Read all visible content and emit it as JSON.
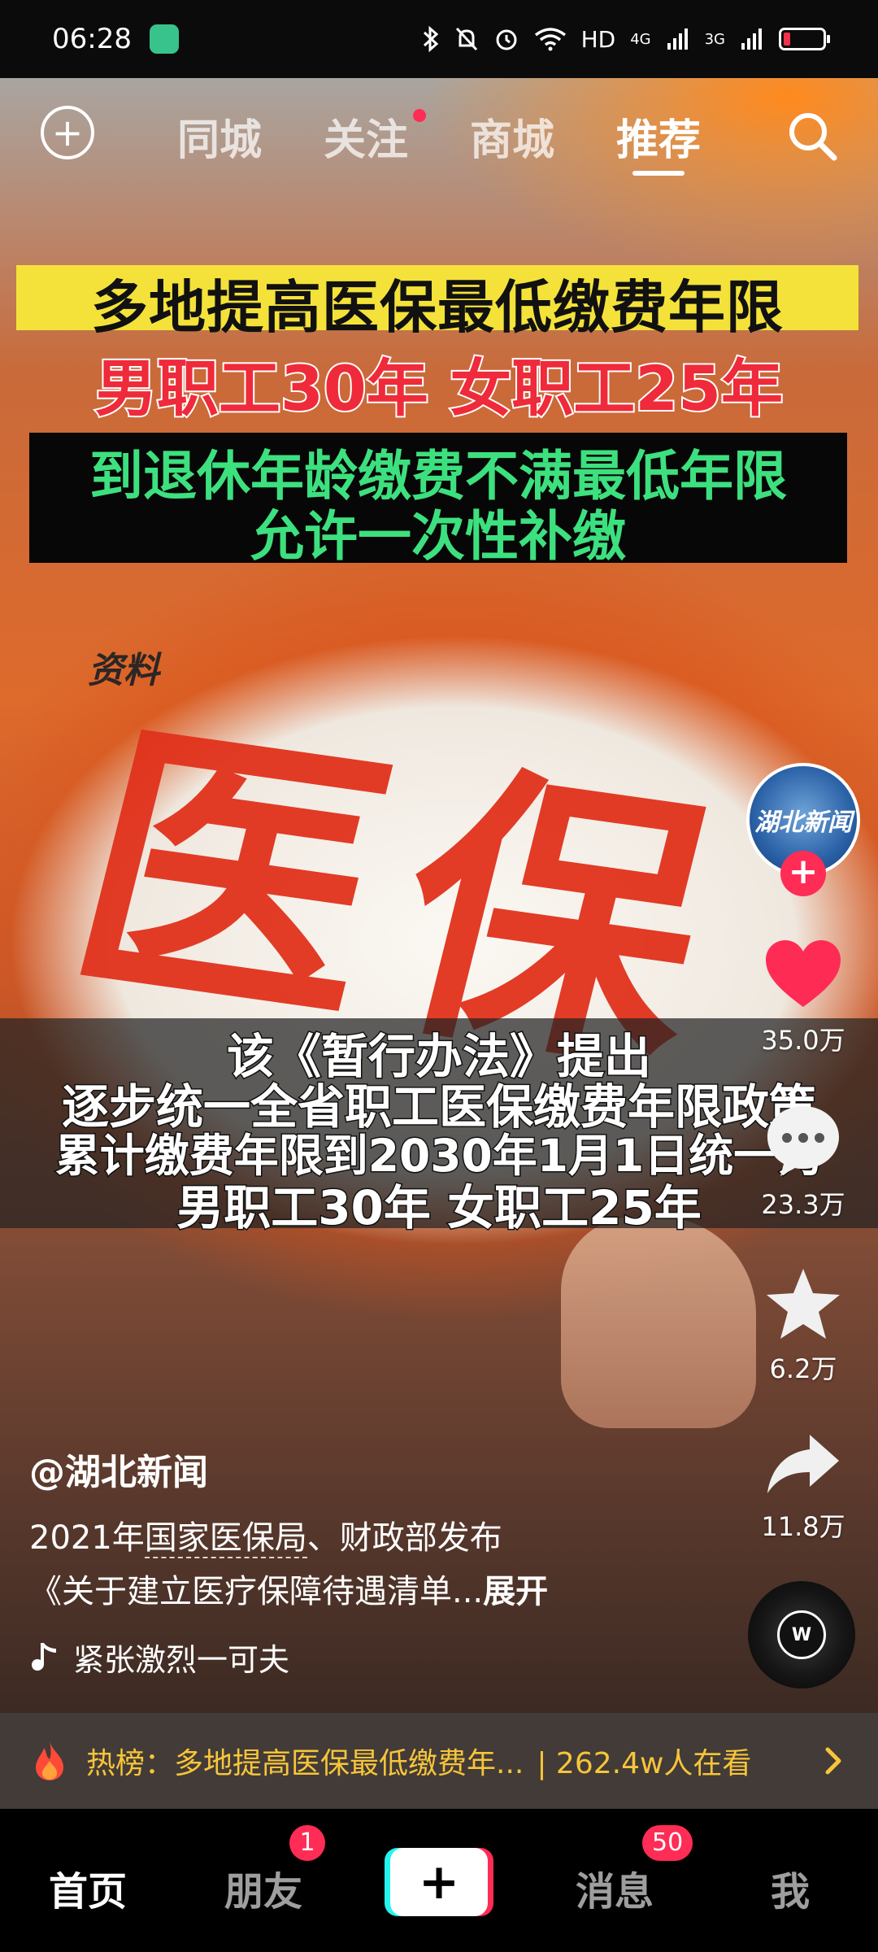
{
  "status_bar": {
    "time": "06:28",
    "network": "HD",
    "signal_1": "4G",
    "signal_2": "3G"
  },
  "top_nav": {
    "tabs": [
      {
        "label": "同城",
        "active": false
      },
      {
        "label": "关注",
        "active": false,
        "has_dot": true
      },
      {
        "label": "商城",
        "active": false
      },
      {
        "label": "推荐",
        "active": true
      }
    ]
  },
  "video": {
    "headline_1": "多地提高医保最低缴费年限",
    "headline_2": "男职工30年 女职工25年",
    "headline_3": "到退休年龄缴费不满最低年限",
    "headline_4": "允许一次性补缴",
    "source_label": "资料",
    "big_text": "医保",
    "subtitles": [
      "该《暂行办法》提出",
      "逐步统一全省职工医保缴费年限政策",
      "累计缴费年限到2030年1月1日统一为",
      "男职工30年 女职工25年"
    ]
  },
  "actions": {
    "avatar_label": "湖北新闻",
    "likes": "35.0万",
    "comments": "23.3万",
    "favorites": "6.2万",
    "shares": "11.8万"
  },
  "caption": {
    "author": "@湖北新闻",
    "desc_prefix": "2021年",
    "desc_link": "国家医保局",
    "desc_suffix": "、财政部发布",
    "desc_line2": "《关于建立医疗保障待遇清单...",
    "expand_label": "展开",
    "music": "紧张激烈一可夫"
  },
  "hot_banner": {
    "text": "热榜：多地提高医保最低缴费年...",
    "viewers": "| 262.4w人在看"
  },
  "bottom_tabs": [
    {
      "label": "首页",
      "active": true
    },
    {
      "label": "朋友",
      "badge": "1"
    },
    {
      "label": "消息",
      "badge": "50"
    },
    {
      "label": "我"
    }
  ],
  "colors": {
    "accent_red": "#ff2c55",
    "hot_text": "#f7c53a",
    "headline_yellow": "#f4e23a",
    "headline_green": "#3de07e",
    "headline_red": "#ef2a3a"
  }
}
